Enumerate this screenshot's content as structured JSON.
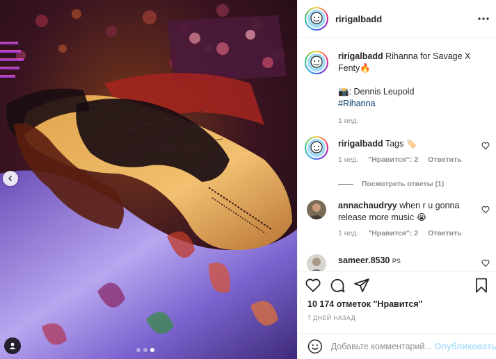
{
  "post": {
    "author": "ririgalbadd",
    "more_icon": "more-horizontal-icon",
    "caption": {
      "text": "Rihanna for Savage X Fenty",
      "emoji": "🔥",
      "credit": ": Dennis Leupold",
      "camera_emoji": "📸",
      "hashtag": "#Rihanna",
      "time": "1 нед."
    },
    "comments": [
      {
        "user": "ririgalbadd",
        "text": "Tags",
        "emoji": "🏷️",
        "time": "1 нед.",
        "likes": "\"Нравится\": 2",
        "reply": "Ответить"
      },
      {
        "user": "annachaudryy",
        "text": "when r u gonna release more music",
        "emoji": "😭",
        "time": "1 нед.",
        "likes": "\"Нравится\": 2",
        "reply": "Ответить"
      },
      {
        "user": "sameer.8530",
        "text": "PS"
      }
    ],
    "view_replies": "Посмотреть ответы (1)",
    "likes_count": "10 174 отметок \"Нравится\"",
    "posted_ago": "7 ДНЕЙ НАЗАД",
    "add_comment_placeholder": "Добавьте комментарий...",
    "publish_label": "Опубликовать",
    "carousel": {
      "slides": 3,
      "active": 2
    }
  },
  "colors": {
    "text": "#262626",
    "muted": "#8e8e8e",
    "hashtag": "#00376b",
    "publish_disabled": "#b2dffc",
    "border": "#efefef"
  }
}
